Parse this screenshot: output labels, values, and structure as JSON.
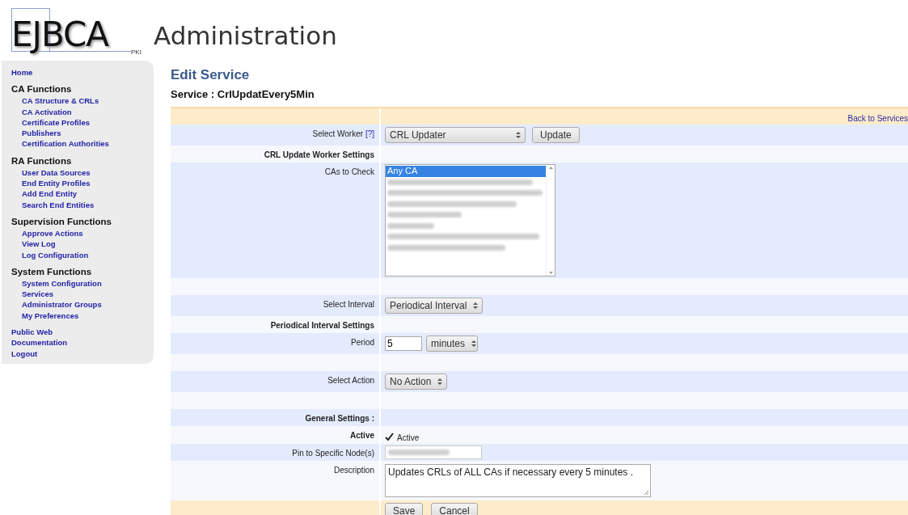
{
  "header": {
    "logo": "EJBCA",
    "logo_sub": "PKI",
    "title": "Administration"
  },
  "sidebar": {
    "groups": [
      {
        "kind": "links",
        "items": [
          "Home"
        ]
      },
      {
        "kind": "section",
        "title": "CA Functions",
        "items": [
          "CA Structure & CRLs",
          "CA Activation",
          "Certificate Profiles",
          "Publishers",
          "Certification Authorities"
        ]
      },
      {
        "kind": "section",
        "title": "RA Functions",
        "items": [
          "User Data Sources",
          "End Entity Profiles",
          "Add End Entity",
          "Search End Entities"
        ]
      },
      {
        "kind": "section",
        "title": "Supervision Functions",
        "items": [
          "Approve Actions",
          "View Log",
          "Log Configuration"
        ]
      },
      {
        "kind": "section",
        "title": "System Functions",
        "items": [
          "System Configuration",
          "Services",
          "Administrator Groups",
          "My Preferences"
        ]
      },
      {
        "kind": "links",
        "items": [
          "Public Web",
          "Documentation",
          "Logout"
        ]
      }
    ]
  },
  "page": {
    "title": "Edit Service",
    "subtitle": "Service : CrlUpdatEvery5Min"
  },
  "rows": [
    {
      "kind": "top",
      "link": "Back to Services"
    },
    {
      "kind": "select",
      "label": "Select Worker",
      "help": "[?]",
      "value": "CRL Updater",
      "button": "Update"
    },
    {
      "kind": "heading",
      "label": "CRL Update Worker Settings"
    },
    {
      "kind": "listbox",
      "label": "CAs to Check",
      "items": [
        {
          "kind": "option",
          "text": "Any CA",
          "selected": true
        },
        {
          "kind": "blurred",
          "selected": false
        },
        {
          "kind": "blurred",
          "selected": false
        },
        {
          "kind": "blurred",
          "selected": false
        },
        {
          "kind": "blurred",
          "selected": false
        },
        {
          "kind": "blurred",
          "selected": false
        },
        {
          "kind": "blurred",
          "selected": false
        },
        {
          "kind": "blurred",
          "selected": false
        }
      ]
    },
    {
      "kind": "blank"
    },
    {
      "kind": "select",
      "label": "Select Interval",
      "value": "Periodical Interval"
    },
    {
      "kind": "heading",
      "label": "Periodical Interval Settings"
    },
    {
      "kind": "period",
      "label": "Period",
      "value": "5",
      "unit": "minutes"
    },
    {
      "kind": "blank"
    },
    {
      "kind": "select",
      "label": "Select Action",
      "value": "No Action"
    },
    {
      "kind": "blank"
    },
    {
      "kind": "heading",
      "label": "General Settings :"
    },
    {
      "kind": "checkbox",
      "label": "Active",
      "text": "Active",
      "checked": true
    },
    {
      "kind": "blurred-input",
      "label": "Pin to Specific Node(s)"
    },
    {
      "kind": "textarea",
      "label": "Description",
      "value": "Updates CRLs of ALL CAs if necessary every 5 minutes ."
    },
    {
      "kind": "buttons",
      "buttons": [
        "Save",
        "Cancel"
      ]
    }
  ]
}
